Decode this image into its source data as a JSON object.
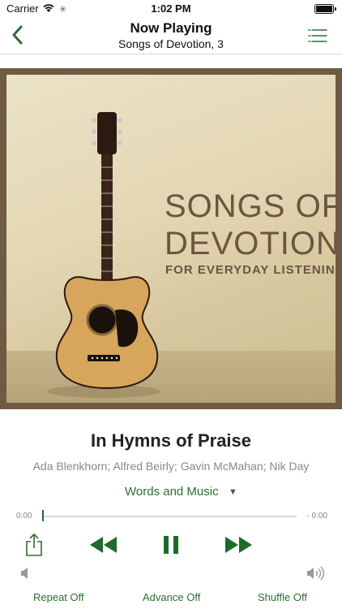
{
  "status_bar": {
    "carrier": "Carrier",
    "time": "1:02 PM"
  },
  "nav": {
    "title": "Now Playing",
    "subtitle": "Songs of Devotion, 3"
  },
  "album_art": {
    "title_line1": "SONGS OF",
    "title_line2": "DEVOTION",
    "tagline": "FOR EVERYDAY LISTENING"
  },
  "track": {
    "title": "In Hymns of Praise",
    "artists": "Ada Blenkhorn; Alfred Beirly; Gavin McMahan; Nik Day"
  },
  "version_select": {
    "value": "Words and Music",
    "caret": "▼"
  },
  "progress": {
    "elapsed": "0:00",
    "remaining": "- 0:00",
    "fraction": 0.0
  },
  "playback": {
    "state": "playing"
  },
  "modes": {
    "repeat": "Repeat Off",
    "advance": "Advance Off",
    "shuffle": "Shuffle Off"
  },
  "colors": {
    "accent": "#2d6e32",
    "frame": "#6f5a43",
    "album_text": "#6b5440"
  }
}
